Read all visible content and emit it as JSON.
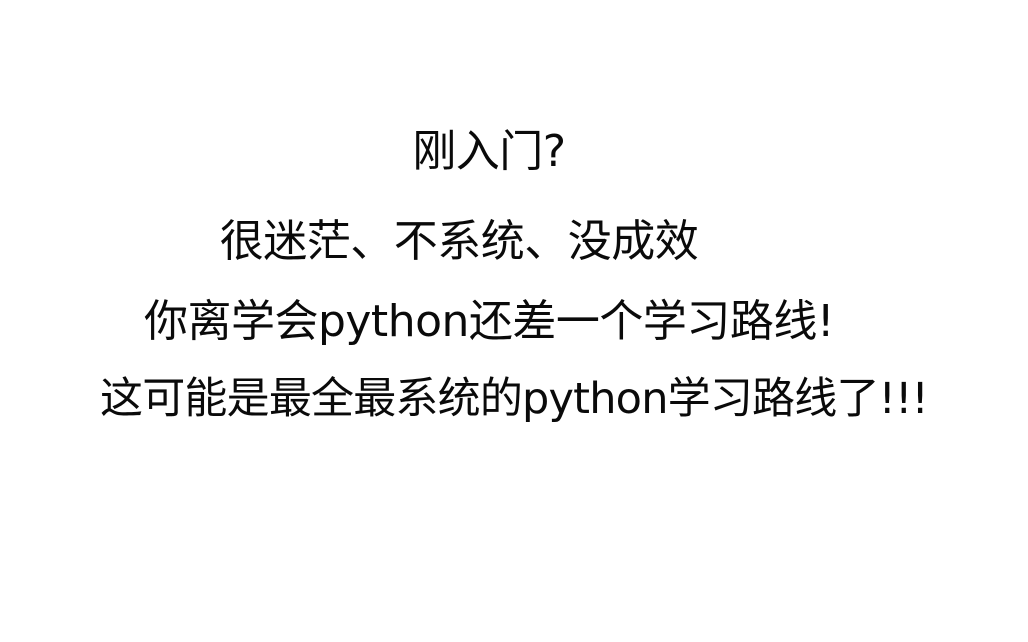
{
  "text": {
    "line1": "刚入门?",
    "line2": "很迷茫、不系统、没成效",
    "line3": "你离学会python还差一个学习路线!",
    "line4": "这可能是最全最系统的python学习路线了!!!"
  },
  "colors": {
    "background": "#ffffff",
    "text": "#0a0a0a"
  }
}
